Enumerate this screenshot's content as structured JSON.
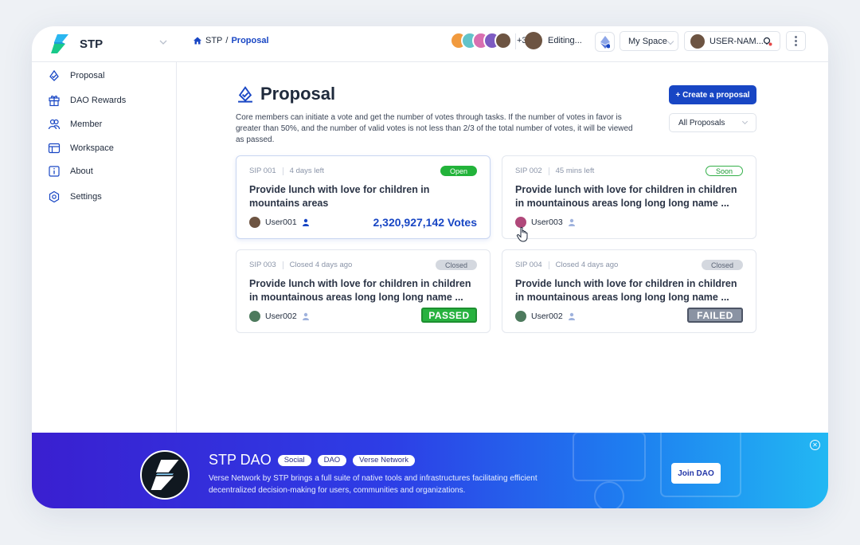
{
  "app": {
    "name": "STP"
  },
  "breadcrumb": {
    "root": "STP",
    "sep": "/",
    "current": "Proposal"
  },
  "topbar": {
    "collaborators_more": "+31",
    "editing_label": "Editing...",
    "space_label": "My Space",
    "user_label": "USER-NAM..."
  },
  "sidebar": {
    "items": [
      {
        "label": "Proposal",
        "icon": "proposal-icon"
      },
      {
        "label": "DAO Rewards",
        "icon": "gift-icon"
      },
      {
        "label": "Member",
        "icon": "members-icon"
      },
      {
        "label": "Workspace",
        "icon": "workspace-icon"
      },
      {
        "label": "About",
        "icon": "info-icon"
      },
      {
        "label": "Settings",
        "icon": "gear-icon"
      }
    ]
  },
  "main": {
    "title": "Proposal",
    "create_button": "+ Create a proposal",
    "description": "Core members can initiate a vote and get the number of votes through tasks. If the number of votes in favor is greater than 50%, and the number of valid votes is not less than 2/3 of the total number of votes, it will be viewed as passed.",
    "filter": "All Proposals"
  },
  "proposals": [
    {
      "id": "SIP 001",
      "time": "4 days left",
      "status": "Open",
      "title": "Provide lunch with love for children in mountains areas",
      "user": "User001",
      "votes": "2,320,927,142 Votes"
    },
    {
      "id": "SIP 002",
      "time": "45 mins left",
      "status": "Soon",
      "title": "Provide lunch with love for children in children in mountainous areas long long long name ...",
      "user": "User003"
    },
    {
      "id": "SIP 003",
      "time": "Closed 4 days ago",
      "status": "Closed",
      "title": "Provide lunch with love for children in children in mountainous areas long long long name ...",
      "user": "User002",
      "result": "PASSED"
    },
    {
      "id": "SIP 004",
      "time": "Closed 4 days ago",
      "status": "Closed",
      "title": "Provide lunch with love for children in children in mountainous areas long long long name ...",
      "user": "User002",
      "result": "FAILED"
    }
  ],
  "banner": {
    "title": "STP DAO",
    "tags": [
      "Social",
      "DAO",
      "Verse Network"
    ],
    "description": "Verse Network by STP brings a full suite of native tools and infrastructures facilitating efficient decentralized decision-making for users, communities and organizations.",
    "join_button": "Join DAO"
  },
  "colors": {
    "accent": "#1846c4",
    "open": "#22b33a",
    "closed": "#d4d8df",
    "failed": "#8a93a3"
  }
}
